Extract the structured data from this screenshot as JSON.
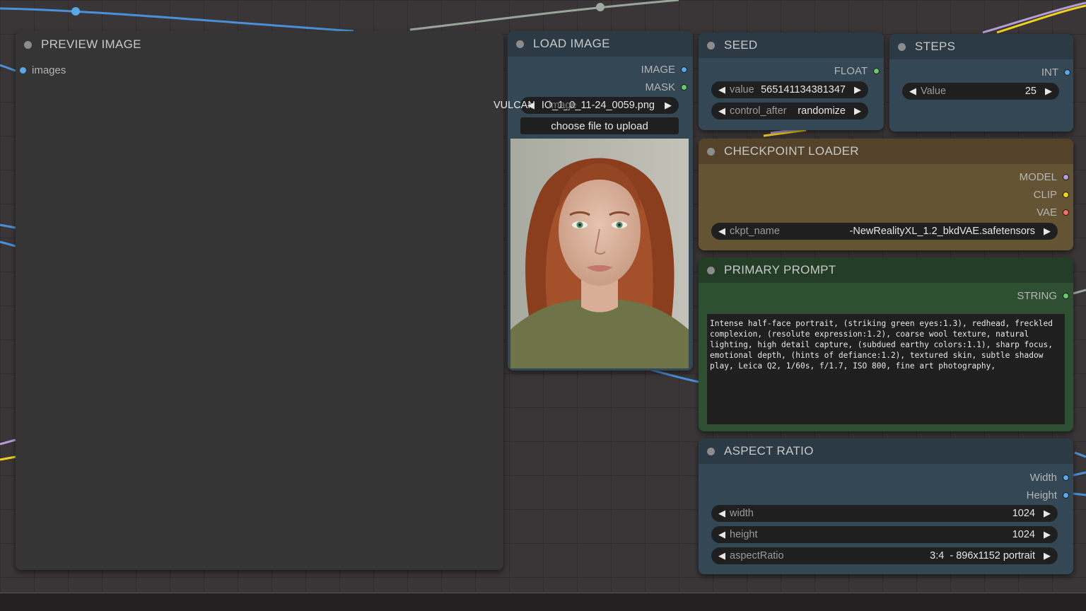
{
  "colors": {
    "canvas": "#3a3536",
    "slot_image": "#5aa8e8",
    "slot_mask": "#6cc86c",
    "slot_float": "#6cc86c",
    "slot_int": "#5aa8e8",
    "slot_model": "#b39ddb",
    "slot_clip": "#f0d020",
    "slot_vae": "#ff6e6e",
    "slot_string": "#6cc86c"
  },
  "preview_image": {
    "title": "PREVIEW IMAGE",
    "input_label": "images"
  },
  "load_image": {
    "title": "LOAD IMAGE",
    "outputs": [
      "IMAGE",
      "MASK"
    ],
    "image_widget": {
      "label": "image",
      "overflow_prefix": "VULCAN",
      "value": "IO_1_0_11-24_0059.png"
    },
    "upload_button": "choose file to upload",
    "photo_icon": "portrait-photo-icon"
  },
  "seed": {
    "title": "SEED",
    "output": "FLOAT",
    "value_label": "value",
    "value": "565141134381347",
    "control_label": "control_after",
    "control_value": "randomize"
  },
  "steps": {
    "title": "STEPS",
    "output": "INT",
    "value_label": "Value",
    "value": "25"
  },
  "checkpoint_loader": {
    "title": "CHECKPOINT LOADER",
    "outputs": [
      "MODEL",
      "CLIP",
      "VAE"
    ],
    "ckpt_label": "ckpt_name",
    "ckpt_value": "-NewRealityXL_1.2_bkdVAE.safetensors"
  },
  "primary_prompt": {
    "title": "PRIMARY PROMPT",
    "output": "STRING",
    "text": "Intense half-face portrait, (striking green eyes:1.3), redhead, freckled complexion, (resolute expression:1.2), coarse wool texture, natural lighting, high detail capture, (subdued earthy colors:1.1), sharp focus, emotional depth, (hints of defiance:1.2), textured skin, subtle shadow play, Leica Q2, 1/60s, f/1.7, ISO 800, fine art photography,"
  },
  "aspect_ratio": {
    "title": "ASPECT RATIO",
    "outputs": [
      "Width",
      "Height"
    ],
    "width_label": "width",
    "width_value": "1024",
    "height_label": "height",
    "height_value": "1024",
    "ratio_label": "aspectRatio",
    "ratio_value": "3:4  - 896x1152 portrait"
  }
}
